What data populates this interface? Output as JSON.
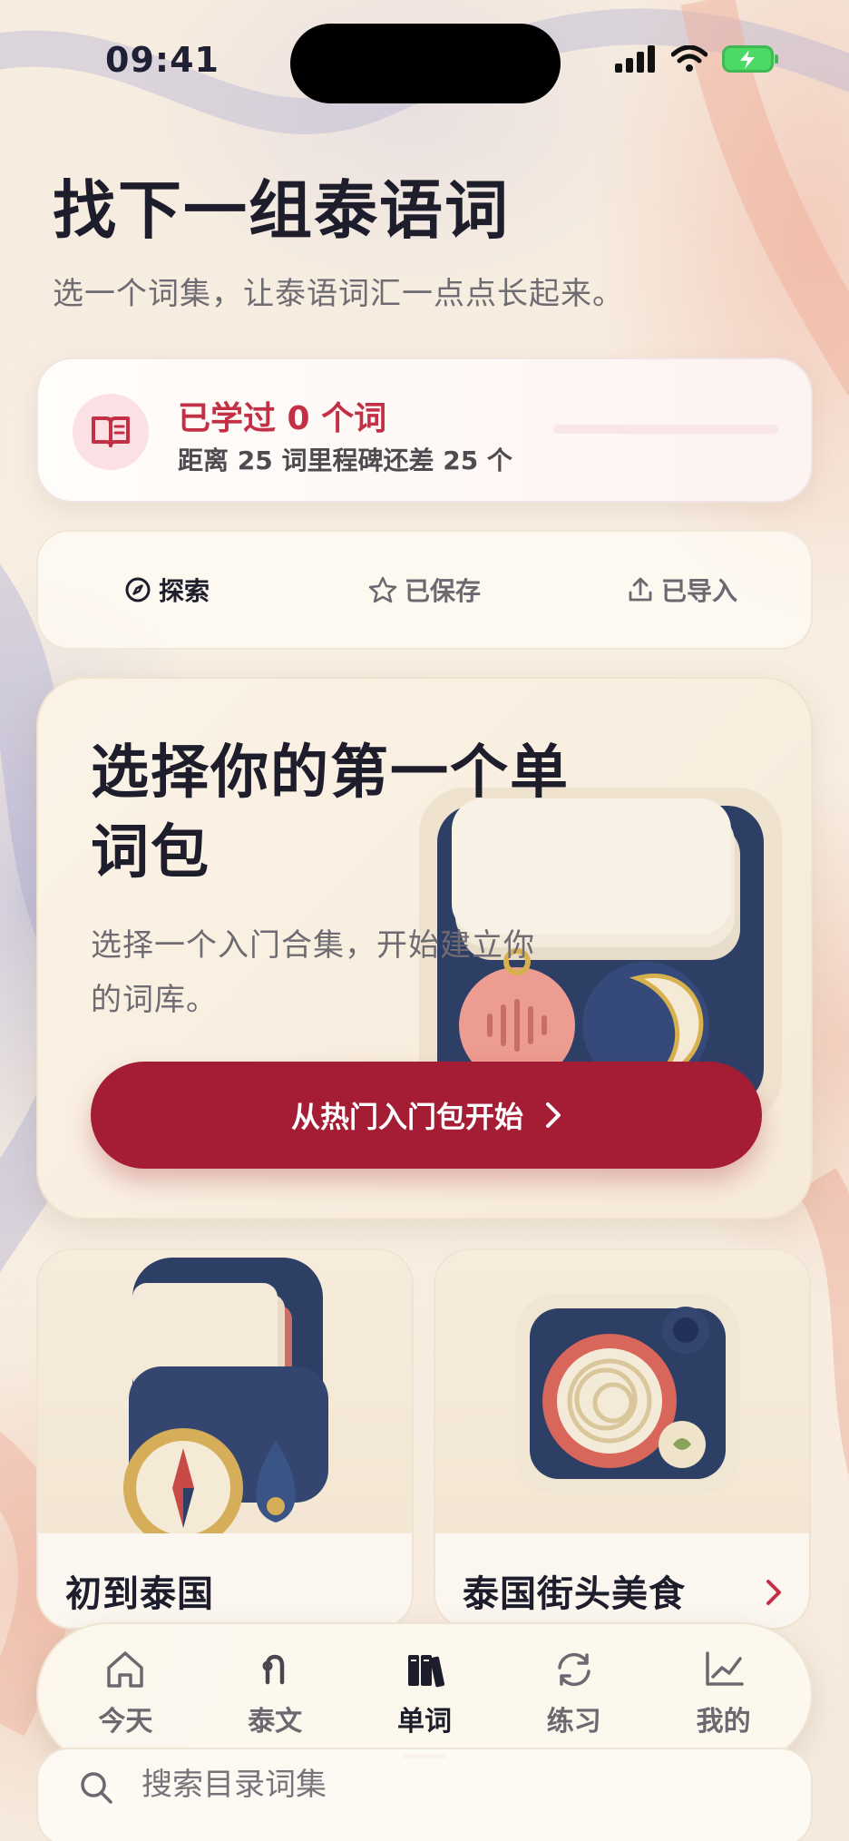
{
  "status_bar": {
    "time": "09:41"
  },
  "header": {
    "title": "找下一组泰语词",
    "subtitle": "选一个词集，让泰语词汇一点点长起来。"
  },
  "progress": {
    "title": "已学过 0 个词",
    "subtitle": "距离 25 词里程碑还差 25 个",
    "fraction": 0
  },
  "tabs": [
    {
      "label": "探索",
      "icon": "compass-icon",
      "active": true
    },
    {
      "label": "已保存",
      "icon": "star-icon",
      "active": false
    },
    {
      "label": "已导入",
      "icon": "upload-icon",
      "active": false
    }
  ],
  "hero": {
    "title": "选择你的第一个单词包",
    "description": "选择一个入门合集，开始建立你的词库。",
    "button_label": "从热门入门包开始"
  },
  "packs": [
    {
      "title": "初到泰国",
      "image": "travel-kit-illustration"
    },
    {
      "title": "泰国街头美食",
      "image": "noodle-tray-illustration"
    }
  ],
  "nav": [
    {
      "label": "今天",
      "icon": "home-icon",
      "active": false
    },
    {
      "label": "泰文",
      "icon": "thai-letter-icon",
      "active": false
    },
    {
      "label": "单词",
      "icon": "books-icon",
      "active": true
    },
    {
      "label": "练习",
      "icon": "refresh-icon",
      "active": false
    },
    {
      "label": "我的",
      "icon": "chart-icon",
      "active": false
    }
  ],
  "search": {
    "placeholder": "搜索目录词集"
  },
  "colors": {
    "accent": "#a51d34",
    "accent_text": "#c32f45",
    "background": "#f6ecdf"
  }
}
